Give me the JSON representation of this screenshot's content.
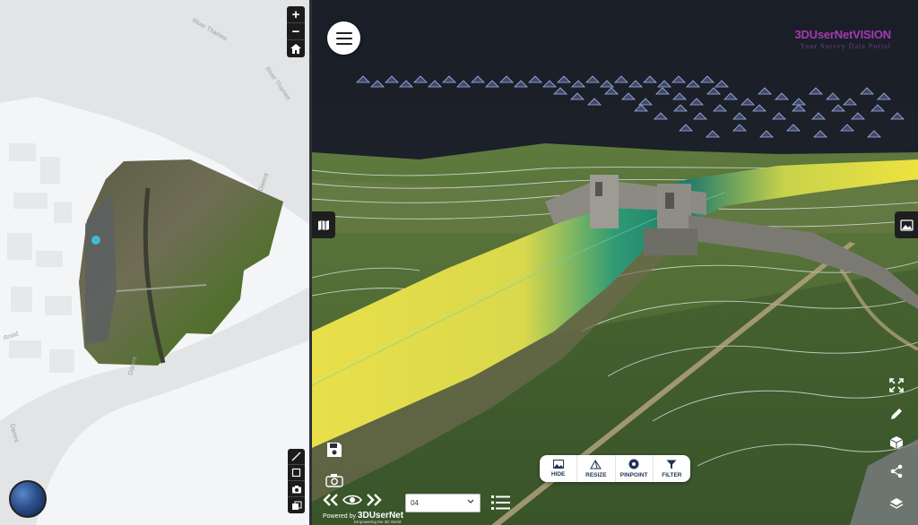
{
  "map2d": {
    "labels": {
      "river_thames_1": "River Thames",
      "river_thames_2": "River Thames",
      "darent_1": "Darent",
      "darent_2": "Darent",
      "darent_3": "Darent",
      "road_1": "Road"
    },
    "zoom_in": "+",
    "zoom_out": "−"
  },
  "viewer": {
    "brand": {
      "name": "3DUserNetVISION",
      "tagline": "Your Survey Data Portal"
    },
    "toolbar": [
      {
        "id": "hide",
        "label": "HIDE",
        "icon": "image-icon"
      },
      {
        "id": "resize",
        "label": "RESIZE",
        "icon": "pyramid-icon"
      },
      {
        "id": "pinpoint",
        "label": "PINPOINT",
        "icon": "target-icon"
      },
      {
        "id": "filter",
        "label": "FILTER",
        "icon": "filter-icon"
      }
    ],
    "epoch_select": {
      "value": "04"
    },
    "powered_by": {
      "prefix": "Powered by",
      "brand": "3DUserNet",
      "tagline": "Empowering the 3D World"
    }
  },
  "colors": {
    "accent_brand": "#a23bb0",
    "toolbar_text": "#1f3550",
    "point_cloud_yellow": "#e8e04a",
    "point_cloud_green": "#2f9a74"
  }
}
